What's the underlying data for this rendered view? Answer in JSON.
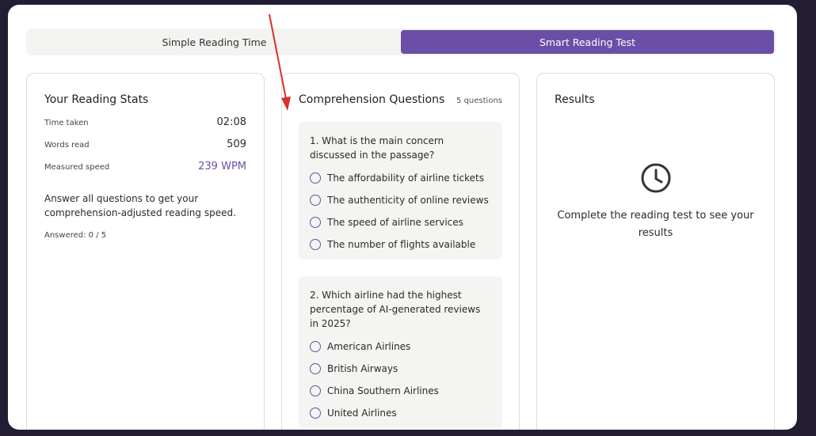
{
  "tabs": [
    {
      "label": "Simple Reading Time",
      "active": false
    },
    {
      "label": "Smart Reading Test",
      "active": true
    }
  ],
  "stats": {
    "title": "Your Reading Stats",
    "time_taken_label": "Time taken",
    "time_taken_value": "02:08",
    "words_read_label": "Words read",
    "words_read_value": "509",
    "speed_label": "Measured speed",
    "speed_value": "239 WPM",
    "note": "Answer all questions to get your comprehension-adjusted reading speed.",
    "answered": "Answered: 0 / 5"
  },
  "questions": {
    "title": "Comprehension Questions",
    "count": "5 questions",
    "items": [
      {
        "text": "1. What is the main concern discussed in the passage?",
        "options": [
          "The affordability of airline tickets",
          "The authenticity of online reviews",
          "The speed of airline services",
          "The number of flights available"
        ]
      },
      {
        "text": "2. Which airline had the highest percentage of AI-generated reviews in 2025?",
        "options": [
          "American Airlines",
          "British Airways",
          "China Southern Airlines",
          "United Airlines"
        ]
      }
    ]
  },
  "results": {
    "title": "Results",
    "icon": "clock-icon",
    "message": "Complete the reading test to see your results"
  },
  "colors": {
    "accent": "#6b4fa6",
    "background": "#231d33",
    "annotation_arrow": "#d9302c"
  }
}
